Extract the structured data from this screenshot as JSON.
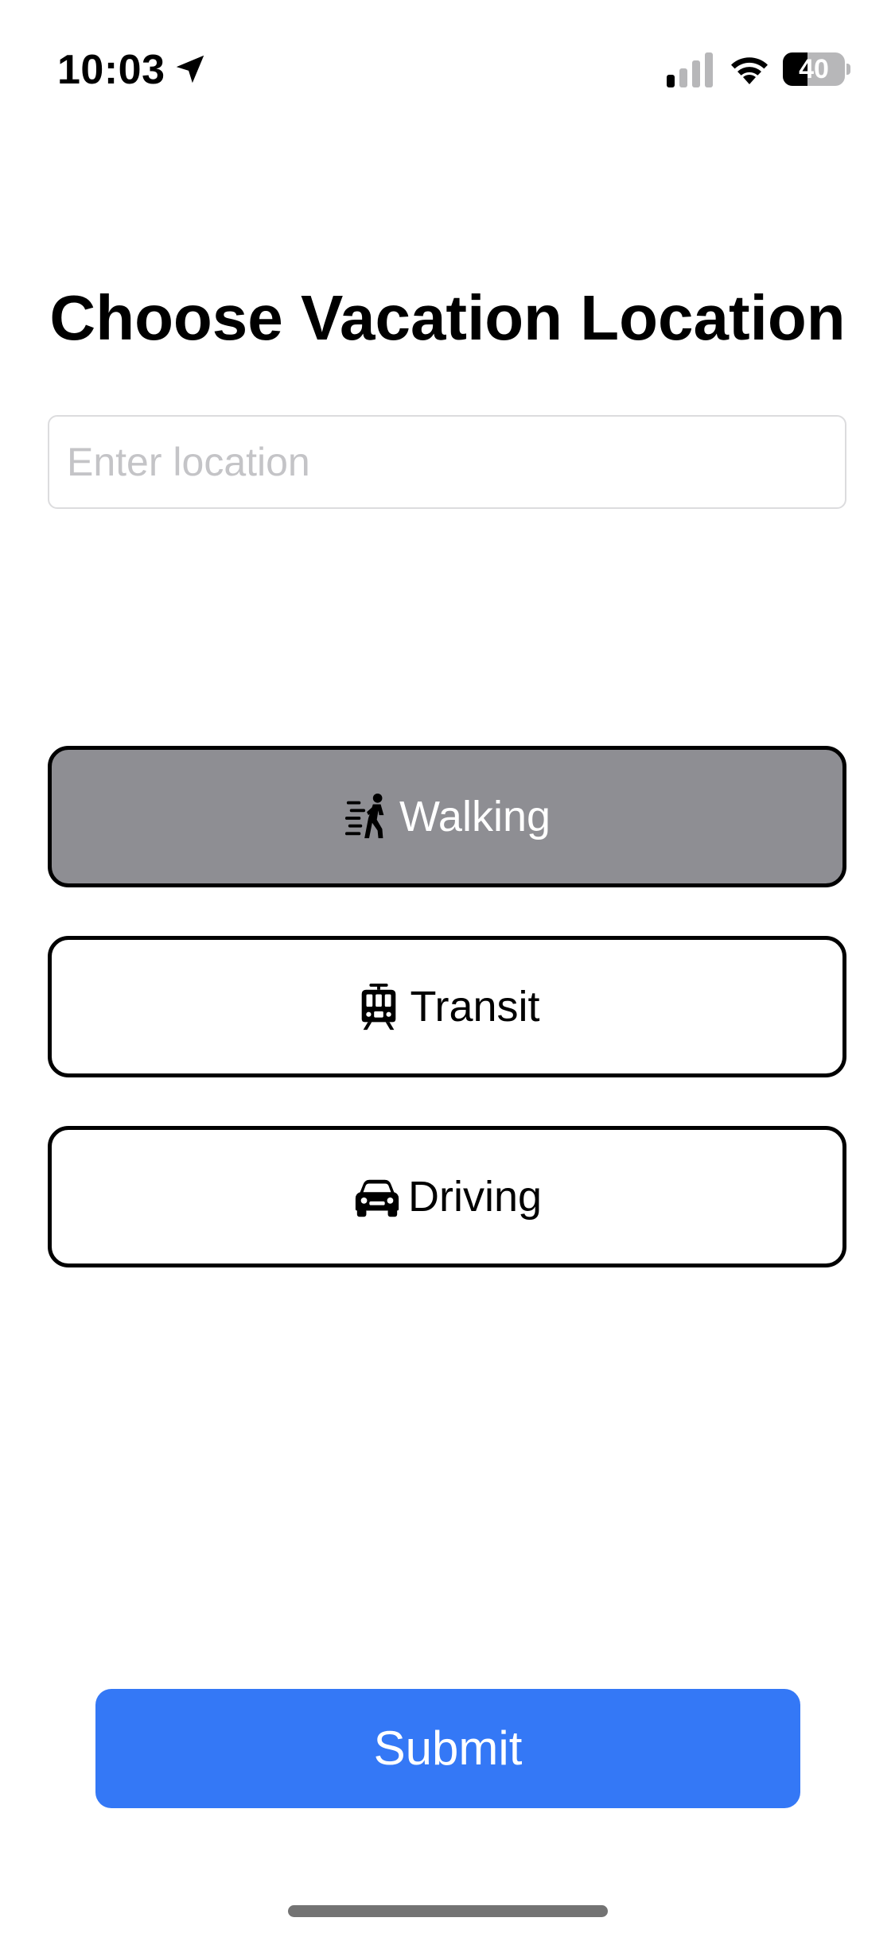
{
  "status_bar": {
    "time": "10:03",
    "battery_percent": "40",
    "battery_level": 0.4
  },
  "title": "Choose Vacation Location",
  "location_input": {
    "value": "",
    "placeholder": "Enter location"
  },
  "modes": [
    {
      "label": "Walking",
      "icon": "walking-figure-icon",
      "selected": true
    },
    {
      "label": "Transit",
      "icon": "tram-icon",
      "selected": false
    },
    {
      "label": "Driving",
      "icon": "car-icon",
      "selected": false
    }
  ],
  "submit": {
    "label": "Submit"
  },
  "colors": {
    "accent": "#3478f6",
    "selected_mode_bg": "#8e8e93",
    "placeholder": "#c4c4c7"
  }
}
